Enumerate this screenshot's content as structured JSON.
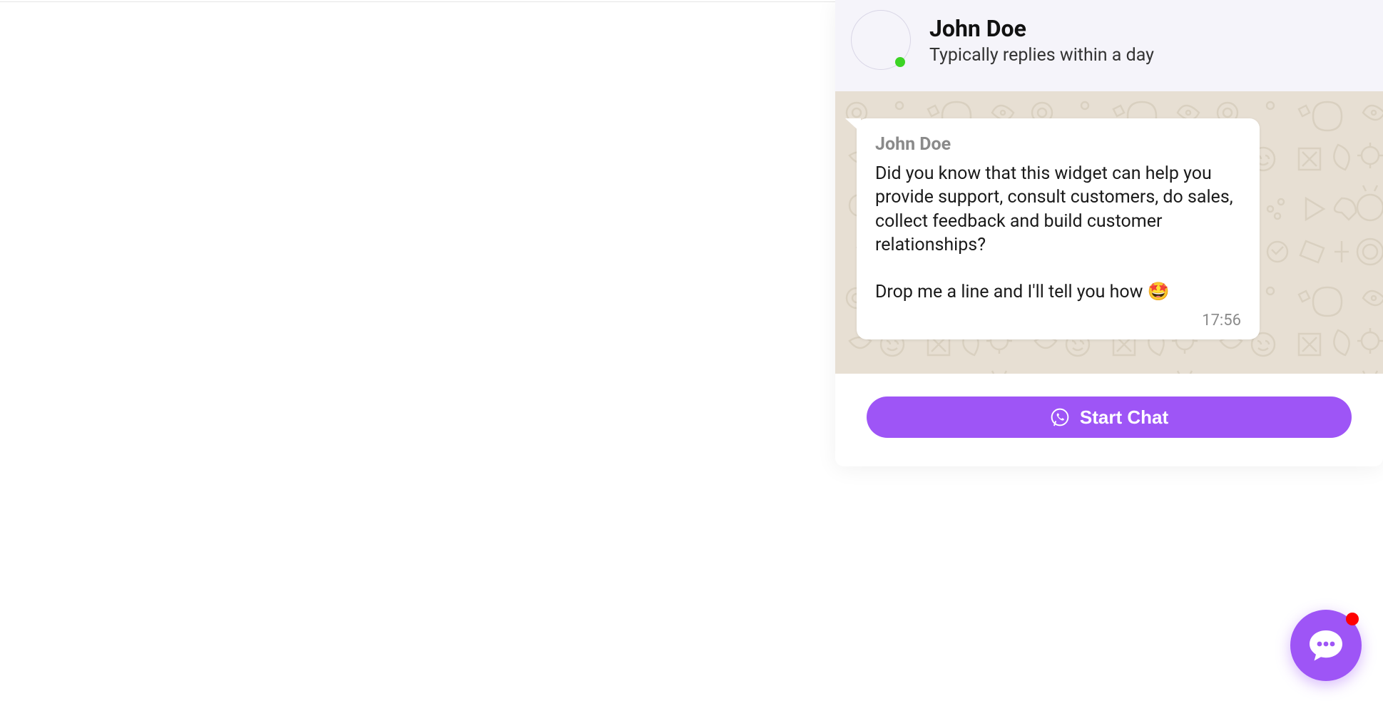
{
  "header": {
    "name": "John Doe",
    "subtitle": "Typically replies within a day",
    "online": true
  },
  "message": {
    "sender": "John Doe",
    "body": "Did you know that this widget can help you provide support, consult customers, do sales, collect feedback and build customer relationships?\n\nDrop me a line and I'll tell you how 🤩",
    "time": "17:56"
  },
  "footer": {
    "button_label": "Start Chat"
  },
  "colors": {
    "accent": "#9e55f6",
    "presence": "#3cd424",
    "badge": "#ff0000",
    "chat_bg": "#e7dfd3",
    "header_bg": "#f5f4fa"
  }
}
